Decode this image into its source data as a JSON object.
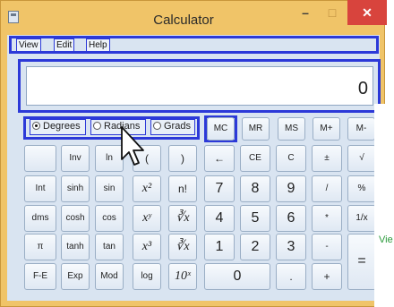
{
  "window": {
    "title": "Calculator",
    "minimize": "–",
    "maximize": "□",
    "close": "✕"
  },
  "menu": {
    "view": "View",
    "edit": "Edit",
    "help": "Help"
  },
  "display": {
    "value": "0"
  },
  "angle_units": {
    "degrees": "Degrees",
    "radians": "Radians",
    "grads": "Grads",
    "selected": "Degrees"
  },
  "keys": {
    "r1": [
      "MC",
      "MR",
      "MS",
      "M+",
      "M-"
    ],
    "r2": [
      "",
      "Inv",
      "ln",
      "(",
      ")",
      "←",
      "CE",
      "C",
      "±",
      "√"
    ],
    "r3": [
      "Int",
      "sinh",
      "sin",
      "x²",
      "n!",
      "7",
      "8",
      "9",
      "/",
      "%"
    ],
    "r4": [
      "dms",
      "cosh",
      "cos",
      "xʸ",
      "∛x",
      "4",
      "5",
      "6",
      "*",
      "1/x"
    ],
    "r5": [
      "π",
      "tanh",
      "tan",
      "x³",
      "∛x",
      "1",
      "2",
      "3",
      "-"
    ],
    "r6": [
      "F-E",
      "Exp",
      "Mod",
      "log",
      "10ˣ",
      "0",
      ".",
      "+"
    ],
    "equals": "="
  },
  "side_panel": {
    "text": "Vie"
  },
  "colors": {
    "highlight": "#2c39d8",
    "frame": "#f0c468",
    "close": "#d8443d"
  }
}
